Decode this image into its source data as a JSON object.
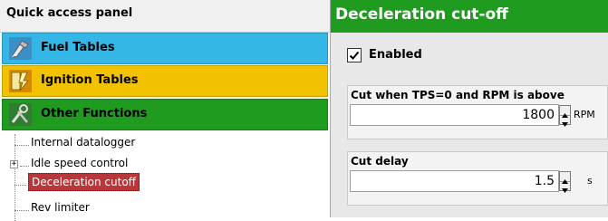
{
  "left_panel": {
    "title": "Quick access panel",
    "categories": [
      {
        "label": "Fuel Tables",
        "color": "#34b7e6",
        "icon": "fuel-injector-icon"
      },
      {
        "label": "Ignition Tables",
        "color": "#f2c200",
        "icon": "ignition-spark-icon"
      },
      {
        "label": "Other Functions",
        "color": "#1f9b1f",
        "icon": "tools-icon"
      }
    ],
    "tree": [
      {
        "label": "Internal datalogger",
        "selected": false,
        "expandable": false
      },
      {
        "label": "Idle speed control",
        "selected": false,
        "expandable": true
      },
      {
        "label": "Deceleration cutoff",
        "selected": true,
        "expandable": false
      },
      {
        "label": "Rev limiter",
        "selected": false,
        "expandable": false
      }
    ]
  },
  "right_panel": {
    "title": "Deceleration cut-off",
    "title_color": "#1f9b1f",
    "enabled": {
      "label": "Enabled",
      "checked": true
    },
    "rpm_group": {
      "label": "Cut when TPS=0 and RPM is above",
      "value": "1800",
      "unit": "RPM"
    },
    "delay_group": {
      "label": "Cut delay",
      "value": "1.5",
      "unit": "s"
    }
  }
}
